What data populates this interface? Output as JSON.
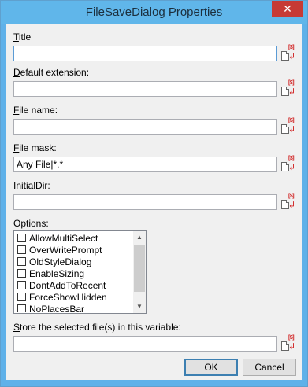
{
  "window": {
    "title": "FileSaveDialog Properties",
    "close_glyph": "✕"
  },
  "fields": {
    "title": {
      "label_key": "T",
      "label_rest": "itle",
      "value": ""
    },
    "default_extension": {
      "label_key": "D",
      "label_rest": "efault extension:",
      "value": ""
    },
    "file_name": {
      "label_key": "F",
      "label_rest": "ile name:",
      "value": ""
    },
    "file_mask": {
      "label_key": "F",
      "label_rest": "ile mask:",
      "value": "Any File|*.*"
    },
    "initial_dir": {
      "label_key": "I",
      "label_rest": "nitialDir:",
      "value": ""
    },
    "store_variable": {
      "label_key": "S",
      "label_rest": "tore the selected file(s) in this variable:",
      "value": ""
    }
  },
  "options": {
    "label": "Options:",
    "items": [
      {
        "label": "AllowMultiSelect",
        "checked": false
      },
      {
        "label": "OverWritePrompt",
        "checked": false
      },
      {
        "label": "OldStyleDialog",
        "checked": false
      },
      {
        "label": "EnableSizing",
        "checked": false
      },
      {
        "label": "DontAddToRecent",
        "checked": false
      },
      {
        "label": "ForceShowHidden",
        "checked": false
      },
      {
        "label": "NoPlacesBar",
        "checked": false
      }
    ]
  },
  "fx_button": {
    "mark": "[$]",
    "arrow": "↲",
    "icon": "variable-insert-icon"
  },
  "buttons": {
    "ok": "OK",
    "cancel": "Cancel"
  }
}
